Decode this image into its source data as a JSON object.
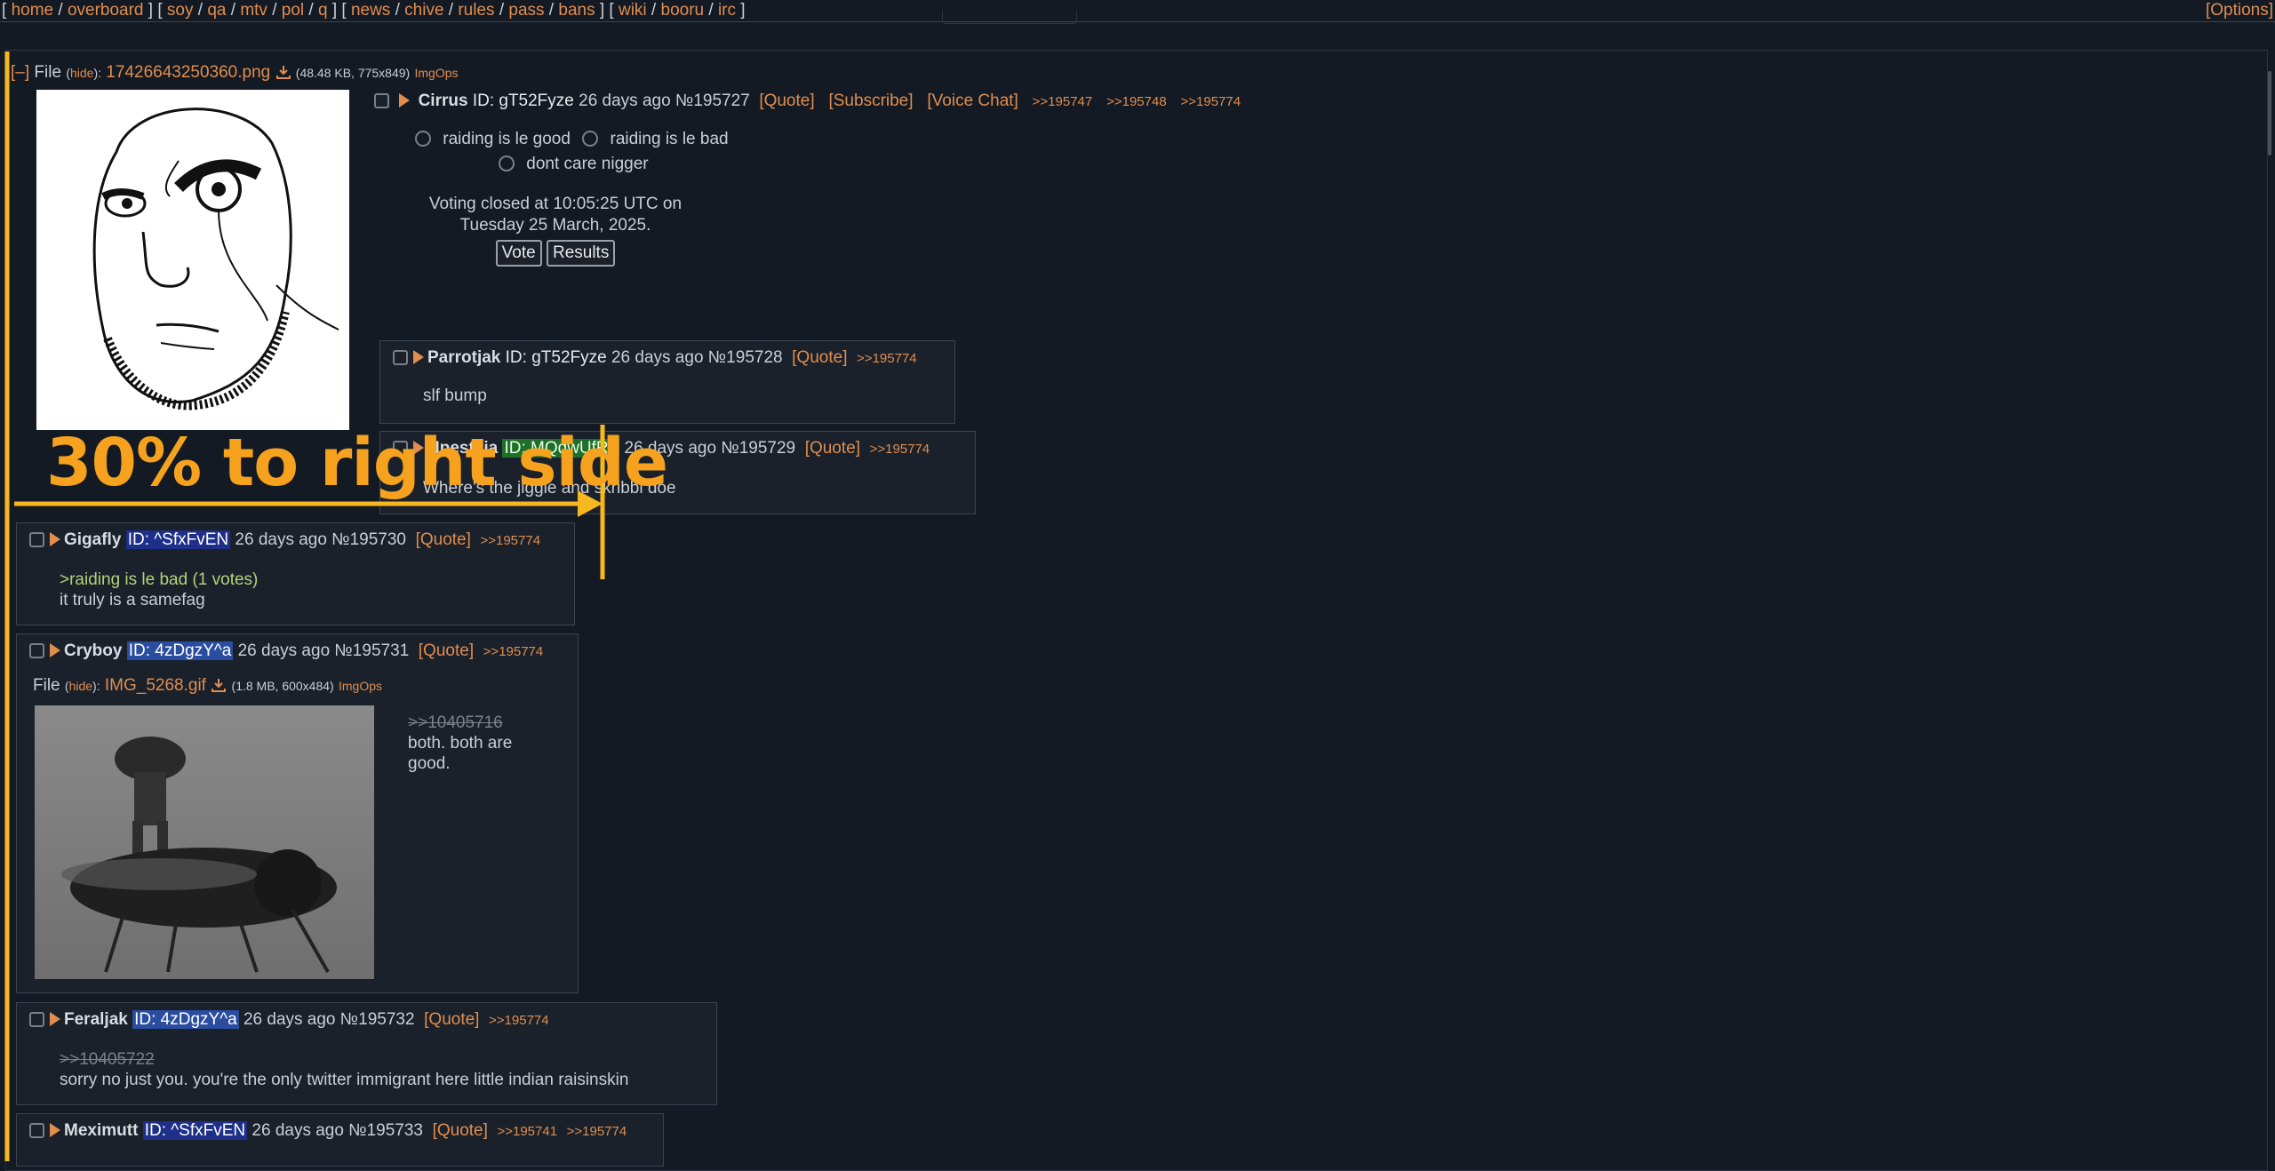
{
  "topnav": {
    "groups": [
      [
        "home",
        "overboard"
      ],
      [
        "soy",
        "qa",
        "mtv",
        "pol",
        "q"
      ],
      [
        "news",
        "chive",
        "rules",
        "pass",
        "bans"
      ],
      [
        "wiki",
        "booru",
        "irc"
      ]
    ],
    "options_label": "[Options]"
  },
  "op": {
    "file_label": "File",
    "hide_label": "hide",
    "filename": "17426643250360.png",
    "filemeta": "(48.48 KB, 775x849)",
    "imgops": "ImgOps",
    "collapse": "[–]",
    "name": "Cirrus",
    "id": "ID: gT52Fyze",
    "time": "26 days ago",
    "no": "№195727",
    "quote": "[Quote]",
    "subscribe": "[Subscribe]",
    "voice": "[Voice Chat]",
    "backlinks": [
      ">>195747",
      ">>195748",
      ">>195774"
    ],
    "poll_options": [
      "raiding is le good",
      "raiding is le bad",
      "dont care nigger"
    ],
    "poll_closed_text": "Voting closed at 10:05:25 UTC on Tuesday 25 March, 2025.",
    "vote_label": "Vote",
    "results_label": "Results"
  },
  "replies": [
    {
      "name": "Parrotjak",
      "id": "ID: gT52Fyze",
      "time": "26 days ago",
      "no": "№195728",
      "quote": "[Quote]",
      "backlinks": [
        ">>195774"
      ],
      "lines": [
        "slf bump"
      ]
    },
    {
      "name": "Npestaia",
      "id": "ID: MQqwUfRn",
      "time": "26 days ago",
      "no": "№195729",
      "quote": "[Quote]",
      "backlinks": [
        ">>195774"
      ],
      "lines": [
        "Where's the jiggle and skribbl doe"
      ]
    },
    {
      "name": "Gigafly",
      "id": "ID: ^SfxFvEN",
      "time": "26 days ago",
      "no": "№195730",
      "quote": "[Quote]",
      "backlinks": [
        ">>195774"
      ],
      "greentext": ">raiding is le bad (1 votes)",
      "lines": [
        "it truly is a samefag"
      ]
    },
    {
      "name": "Cryboy",
      "id": "ID: 4zDgzY^a",
      "time": "26 days ago",
      "no": "№195731",
      "quote": "[Quote]",
      "backlinks": [
        ">>195774"
      ],
      "file_label": "File",
      "hide_label": "hide",
      "filename": "IMG_5268.gif",
      "filemeta": "(1.8 MB, 600x484)",
      "imgops": "ImgOps",
      "deadlink": ">>10405716",
      "lines": [
        "both. both are",
        "good."
      ]
    },
    {
      "name": "Feraljak",
      "id": "ID: 4zDgzY^a",
      "time": "26 days ago",
      "no": "№195732",
      "quote": "[Quote]",
      "backlinks": [
        ">>195774"
      ],
      "deadlink": ">>10405722",
      "lines": [
        "sorry no just you. you're the only twitter immigrant here little indian raisinskin"
      ]
    },
    {
      "name": "Meximutt",
      "id": "ID: ^SfxFvEN",
      "time": "26 days ago",
      "no": "№195733",
      "quote": "[Quote]",
      "backlinks": [
        ">>195741",
        ">>195774"
      ]
    }
  ],
  "annotation": {
    "text": "30% to right side",
    "color": "#f6a21e"
  }
}
